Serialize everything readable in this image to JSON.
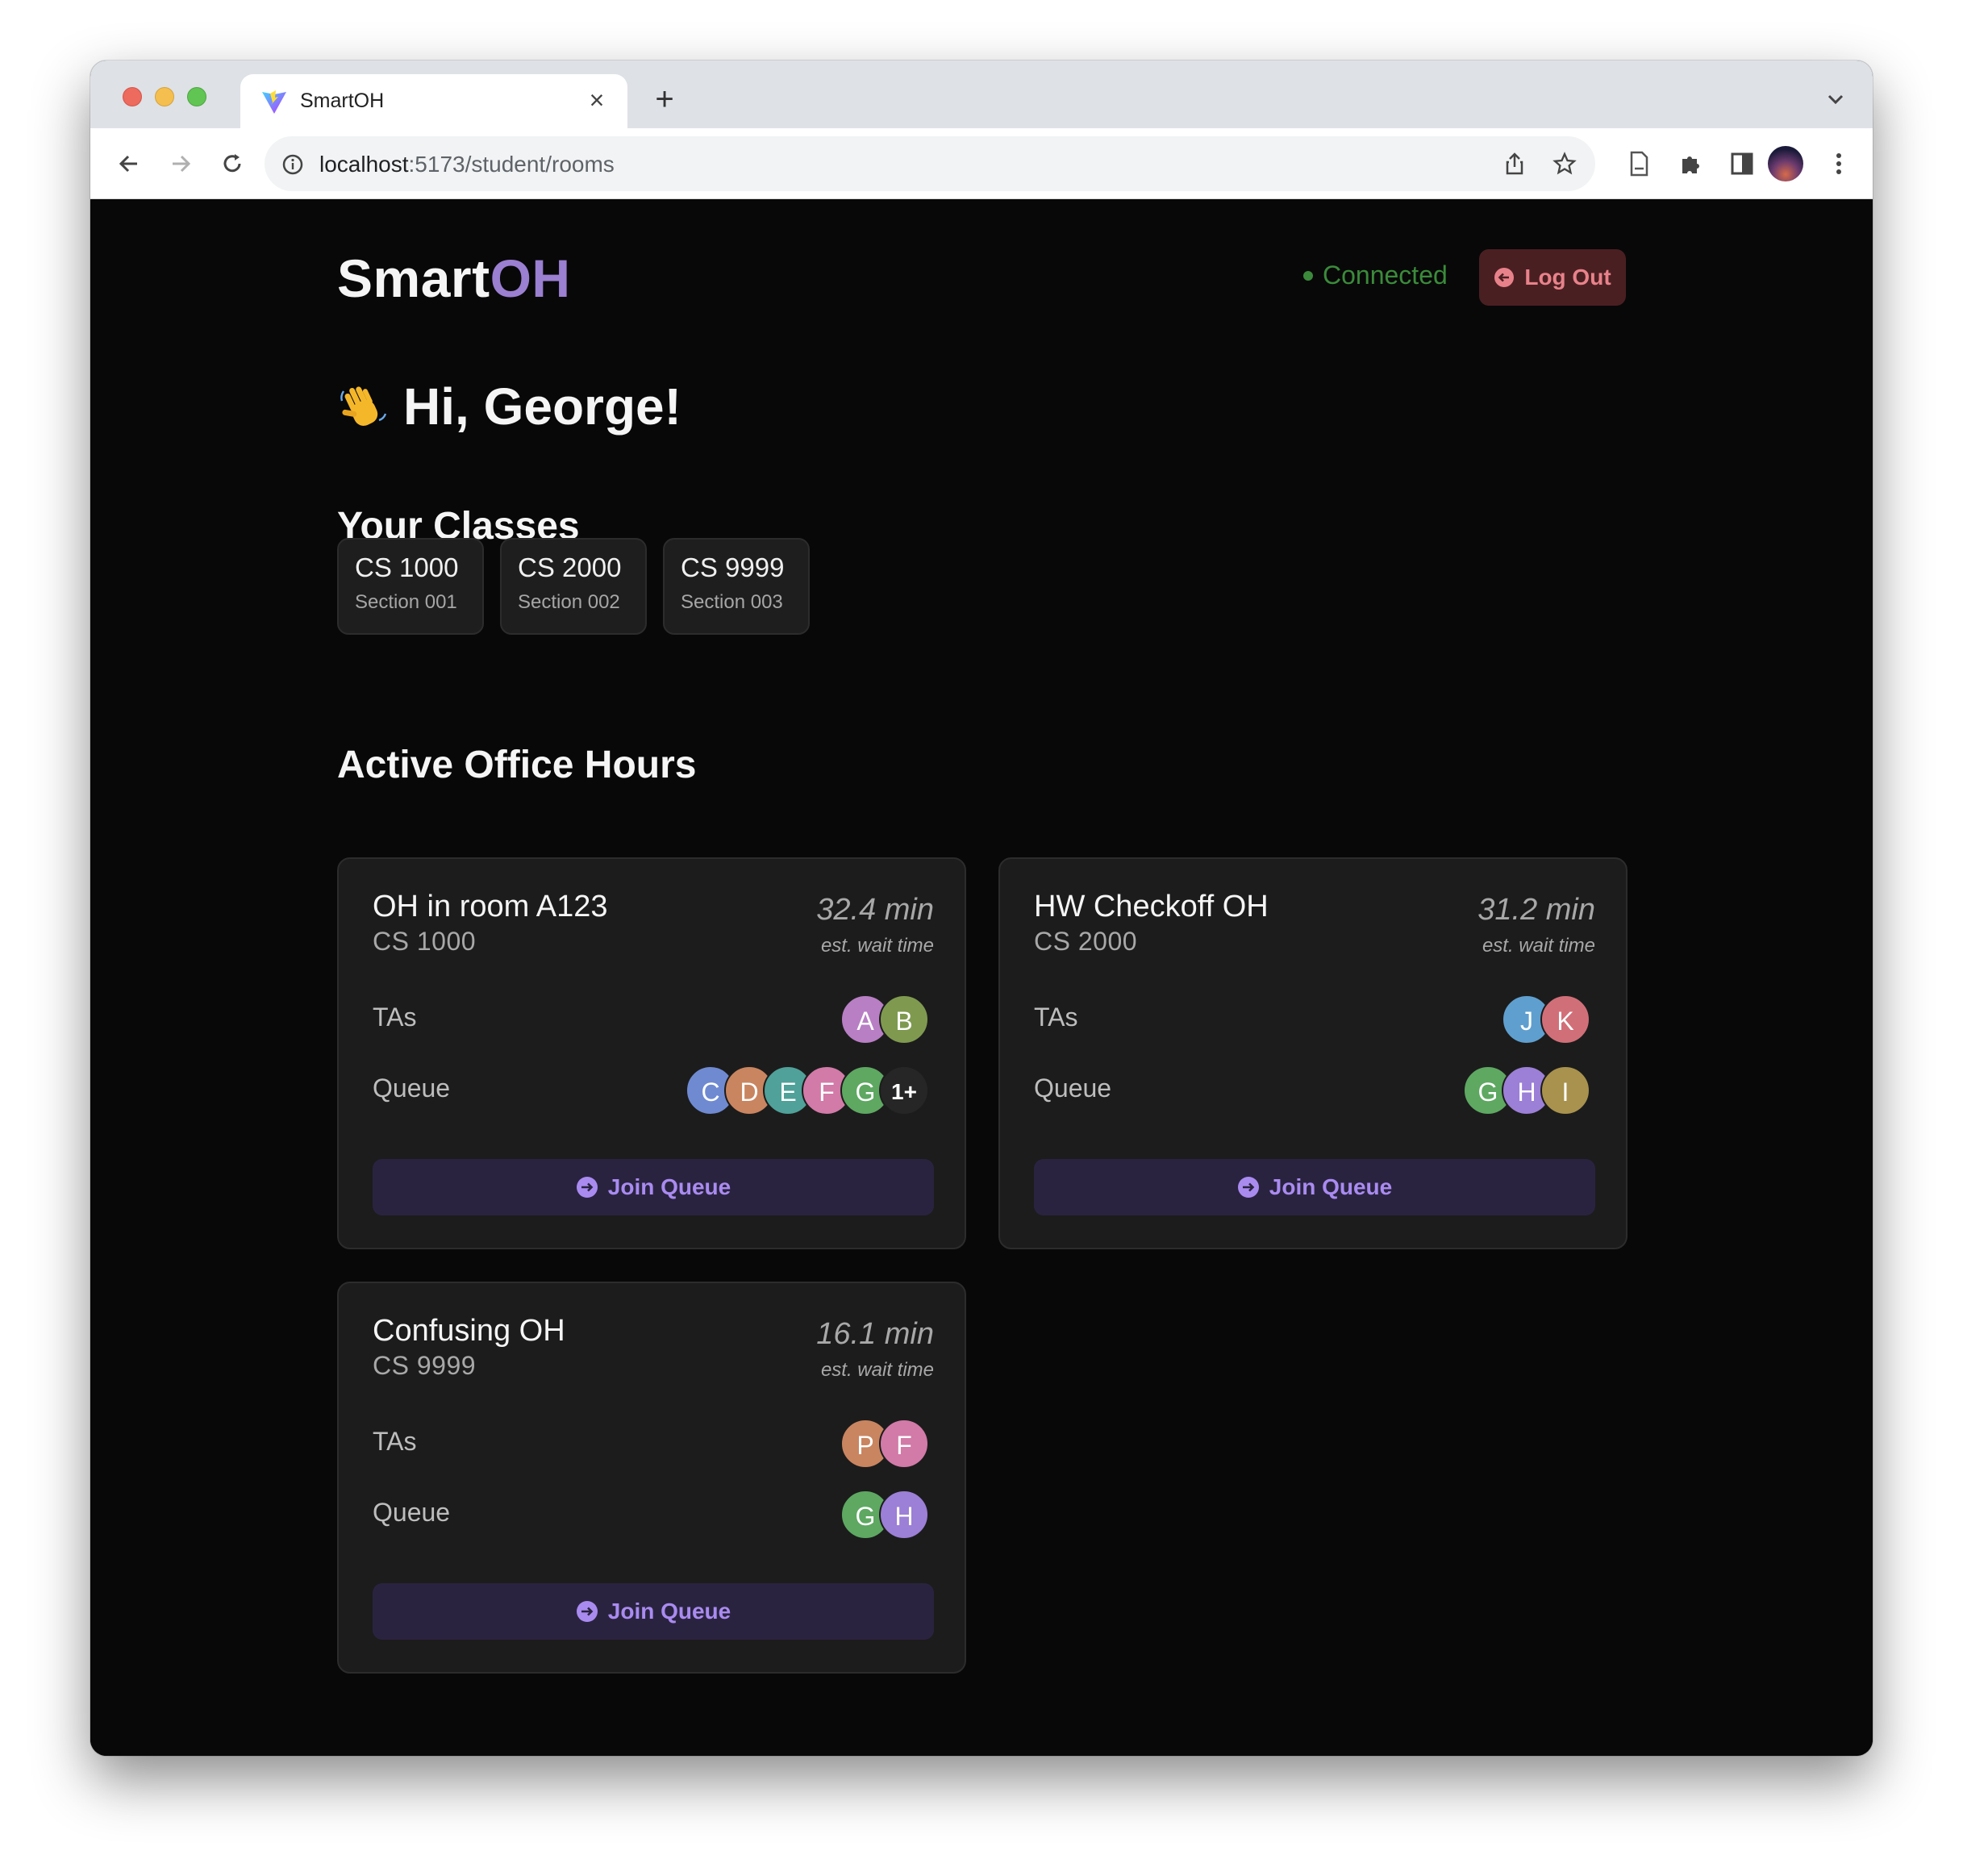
{
  "browser": {
    "tab_title": "SmartOH",
    "url_host": "localhost",
    "url_path": ":5173/student/rooms",
    "new_tab_label": "+",
    "close_label": "×"
  },
  "header": {
    "logo_main": "Smart",
    "logo_accent": "OH",
    "status": "Connected",
    "logout_label": "Log Out"
  },
  "greeting": "Hi, George!",
  "classes_title": "Your Classes",
  "classes": [
    {
      "name": "CS 1000",
      "section": "Section 001"
    },
    {
      "name": "CS 2000",
      "section": "Section 002"
    },
    {
      "name": "CS 9999",
      "section": "Section 003"
    }
  ],
  "office_hours_title": "Active Office Hours",
  "office_hours": [
    {
      "title": "OH in room A123",
      "course": "CS 1000",
      "wait": "32.4 min",
      "wait_label": "est. wait time",
      "tas_label": "TAs",
      "queue_label": "Queue",
      "tas": [
        {
          "initial": "A",
          "color": "#b87fc4"
        },
        {
          "initial": "B",
          "color": "#7f9a4f"
        }
      ],
      "queue": [
        {
          "initial": "C",
          "color": "#6f8ad1"
        },
        {
          "initial": "D",
          "color": "#c98560"
        },
        {
          "initial": "E",
          "color": "#4fa199"
        },
        {
          "initial": "F",
          "color": "#d27aa8"
        },
        {
          "initial": "G",
          "color": "#5ea862"
        }
      ],
      "queue_more": "1+",
      "join_label": "Join Queue"
    },
    {
      "title": "HW Checkoff OH",
      "course": "CS 2000",
      "wait": "31.2 min",
      "wait_label": "est. wait time",
      "tas_label": "TAs",
      "queue_label": "Queue",
      "tas": [
        {
          "initial": "J",
          "color": "#5f9fcf"
        },
        {
          "initial": "K",
          "color": "#d16f78"
        }
      ],
      "queue": [
        {
          "initial": "G",
          "color": "#5ea862"
        },
        {
          "initial": "H",
          "color": "#9c7fd6"
        },
        {
          "initial": "I",
          "color": "#a8924d"
        }
      ],
      "join_label": "Join Queue"
    },
    {
      "title": "Confusing OH",
      "course": "CS 9999",
      "wait": "16.1 min",
      "wait_label": "est. wait time",
      "tas_label": "TAs",
      "queue_label": "Queue",
      "tas": [
        {
          "initial": "P",
          "color": "#c98560"
        },
        {
          "initial": "F",
          "color": "#d27aa8"
        }
      ],
      "queue": [
        {
          "initial": "G",
          "color": "#5ea862"
        },
        {
          "initial": "H",
          "color": "#9c7fd6"
        }
      ],
      "join_label": "Join Queue"
    }
  ]
}
